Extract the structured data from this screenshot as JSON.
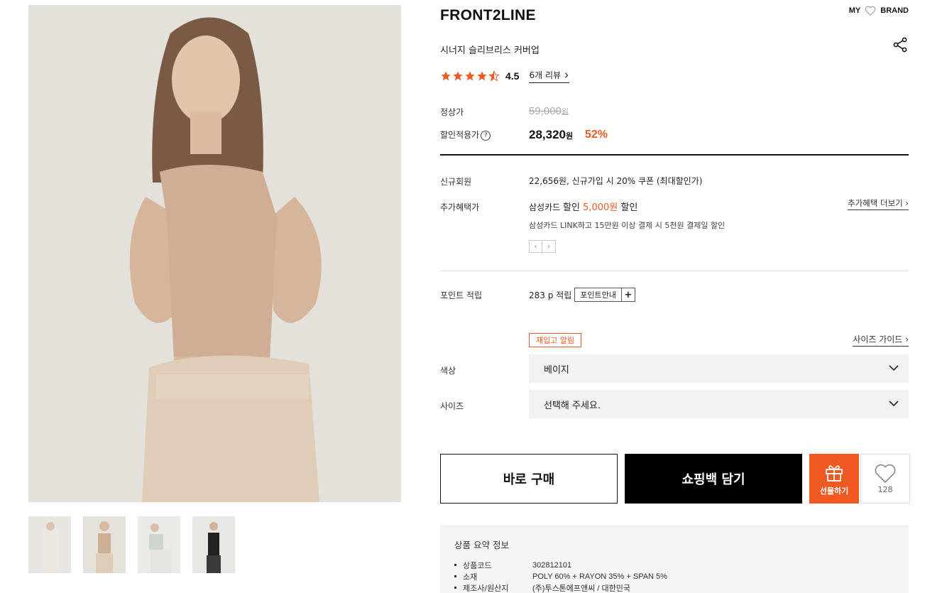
{
  "header": {
    "brand": "FRONT2LINE",
    "my_label": "MY",
    "brand_label": "BRAND"
  },
  "product": {
    "name": "시너지 슬리브리스 커버업",
    "rating": "4.5",
    "rating_value": 4.5,
    "review_link": "6개 리뷰"
  },
  "price": {
    "regular_label": "정상가",
    "regular": "59,000",
    "regular_unit": "원",
    "sale_label": "할인적용가",
    "sale": "28,320",
    "sale_unit": "원",
    "discount": "52%"
  },
  "benefits": {
    "new_member_label": "신규회원",
    "new_member_text": "22,656원, 신규가입 시 20% 쿠폰 (최대할인가)",
    "extra_label": "추가혜택가",
    "card_prefix": "삼성카드 ",
    "card_bold": "할인 ",
    "card_amount": "5,000원",
    "card_suffix": " 할인",
    "card_detail": "삼성카드 LINK하고 15만원 이상 결제 시 5천원 결제일 할인",
    "more_link": "추가혜택 더보기",
    "prev": "‹",
    "next": "›"
  },
  "points": {
    "label": "포인트 적립",
    "value": "283 p 적립",
    "guide": "포인트안내",
    "plus": "+"
  },
  "options": {
    "restock": "재입고 알림",
    "size_guide": "사이즈 가이드",
    "color_label": "색상",
    "color_value": "베이지",
    "size_label": "사이즈",
    "size_value": "선택해 주세요."
  },
  "actions": {
    "buy_now": "바로 구매",
    "add_to_bag": "쇼핑백 담기",
    "gift": "선물하기",
    "like_count": "128"
  },
  "summary": {
    "title": "상품 요약 정보",
    "rows": [
      {
        "k": "상품코드",
        "v": "302812101"
      },
      {
        "k": "소재",
        "v": "POLY 60% + RAYON 35% + SPAN 5%"
      },
      {
        "k": "제조사/원산지",
        "v": "(주)투스톤에프앤씨 / 대한민국"
      }
    ]
  },
  "colors": {
    "accent": "#f05a22",
    "black": "#000000",
    "select_bg": "#f2f2f2",
    "summary_bg": "#f5f5f5"
  },
  "icons": [
    "heart-icon",
    "share-icon",
    "star-icon",
    "chevron-right-icon",
    "question-icon",
    "chevron-down-icon",
    "gift-icon"
  ]
}
